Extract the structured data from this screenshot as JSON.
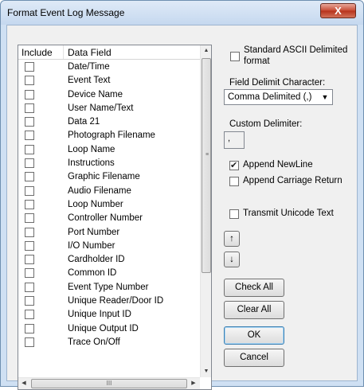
{
  "window": {
    "title": "Format Event Log Message",
    "close_glyph": "X"
  },
  "list": {
    "columns": {
      "include": "Include",
      "field": "Data Field"
    },
    "items": [
      {
        "label": "Date/Time",
        "checked": false
      },
      {
        "label": "Event Text",
        "checked": false
      },
      {
        "label": "Device Name",
        "checked": false
      },
      {
        "label": "User Name/Text",
        "checked": false
      },
      {
        "label": "Data 21",
        "checked": false
      },
      {
        "label": "Photograph Filename",
        "checked": false
      },
      {
        "label": "Loop Name",
        "checked": false
      },
      {
        "label": "Instructions",
        "checked": false
      },
      {
        "label": "Graphic Filename",
        "checked": false
      },
      {
        "label": "Audio Filename",
        "checked": false
      },
      {
        "label": "Loop Number",
        "checked": false
      },
      {
        "label": "Controller Number",
        "checked": false
      },
      {
        "label": "Port Number",
        "checked": false
      },
      {
        "label": "I/O Number",
        "checked": false
      },
      {
        "label": "Cardholder ID",
        "checked": false
      },
      {
        "label": "Common ID",
        "checked": false
      },
      {
        "label": "Event Type Number",
        "checked": false
      },
      {
        "label": "Unique Reader/Door ID",
        "checked": false
      },
      {
        "label": "Unique Input ID",
        "checked": false
      },
      {
        "label": "Unique Output ID",
        "checked": false
      },
      {
        "label": "Trace On/Off",
        "checked": false
      }
    ],
    "hscroll_grip": "III",
    "vscroll_grip": "≡"
  },
  "options": {
    "standard_ascii_line1": "Standard ASCII Delimited",
    "standard_ascii_line2": "format",
    "standard_ascii_checked": false,
    "field_delimit_label": "Field Delimit Character:",
    "field_delimit_value": "Comma Delimited (,)",
    "custom_delimiter_label": "Custom Delimiter:",
    "custom_delimiter_value": ",",
    "append_newline_label": "Append NewLine",
    "append_newline_checked": true,
    "append_cr_label": "Append Carriage Return",
    "append_cr_checked": false,
    "transmit_unicode_label": "Transmit Unicode Text",
    "transmit_unicode_checked": false
  },
  "buttons": {
    "move_up": "↑",
    "move_down": "↓",
    "check_all": "Check All",
    "clear_all": "Clear All",
    "ok": "OK",
    "cancel": "Cancel"
  }
}
